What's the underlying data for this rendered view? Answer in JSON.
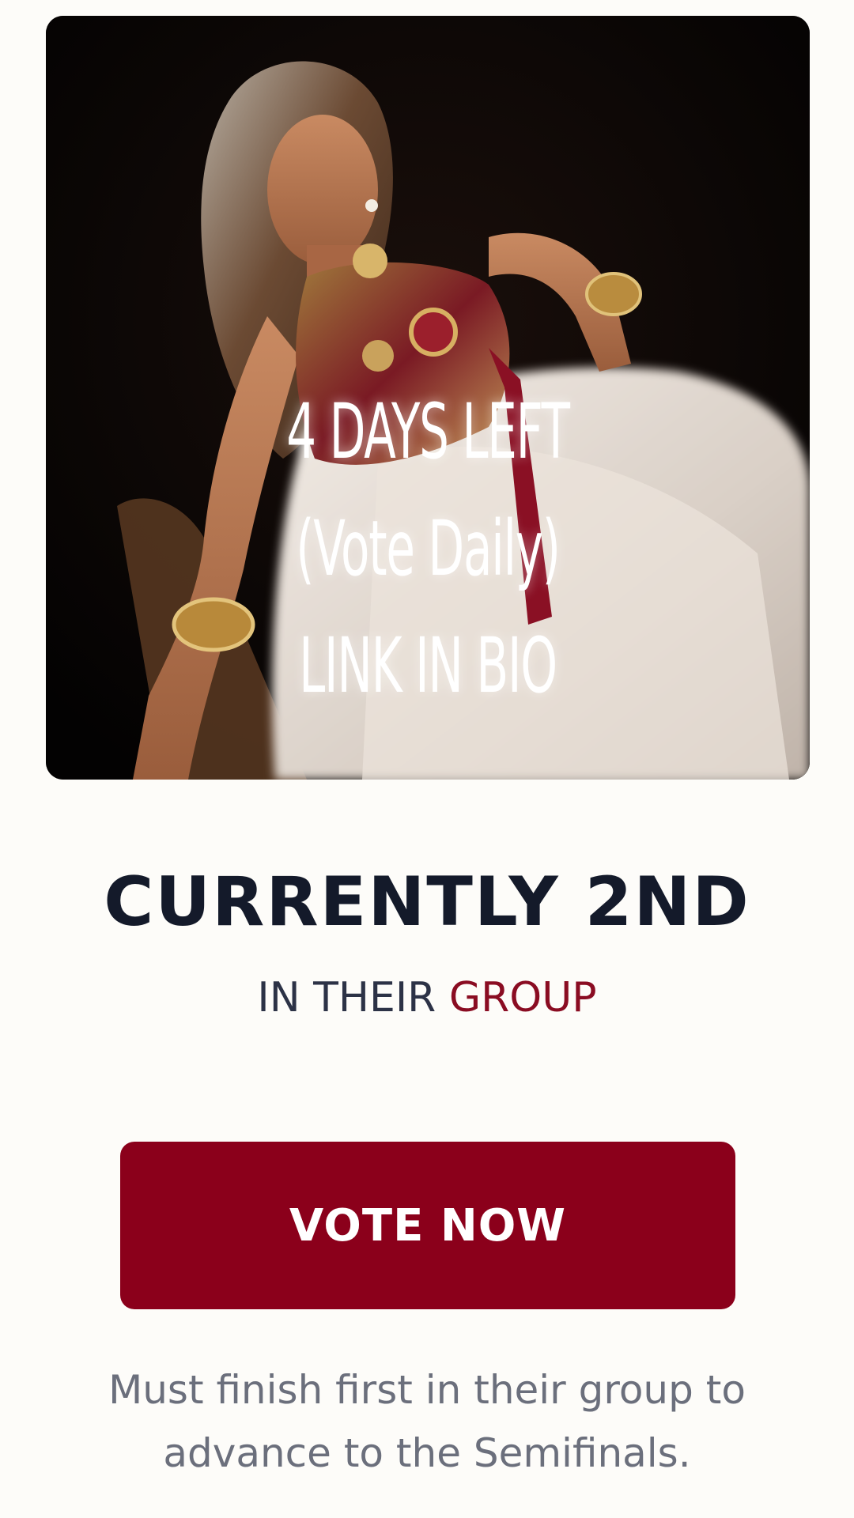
{
  "hero": {
    "overlay_line1": "4 DAYS LEFT",
    "overlay_line2": "(Vote Daily)",
    "overlay_line3": "LINK IN BIO"
  },
  "rank": {
    "headline": "CURRENTLY 2ND",
    "sub_prefix": "IN THEIR ",
    "sub_accent": "GROUP"
  },
  "vote_button": {
    "label": "VOTE NOW"
  },
  "note": {
    "text": "Must finish first in their group to advance to the Semifinals."
  },
  "colors": {
    "background": "#fdfcf9",
    "headline": "#141a2a",
    "accent": "#8a0c22",
    "button": "#8b001b",
    "note": "#6b6f7c"
  }
}
